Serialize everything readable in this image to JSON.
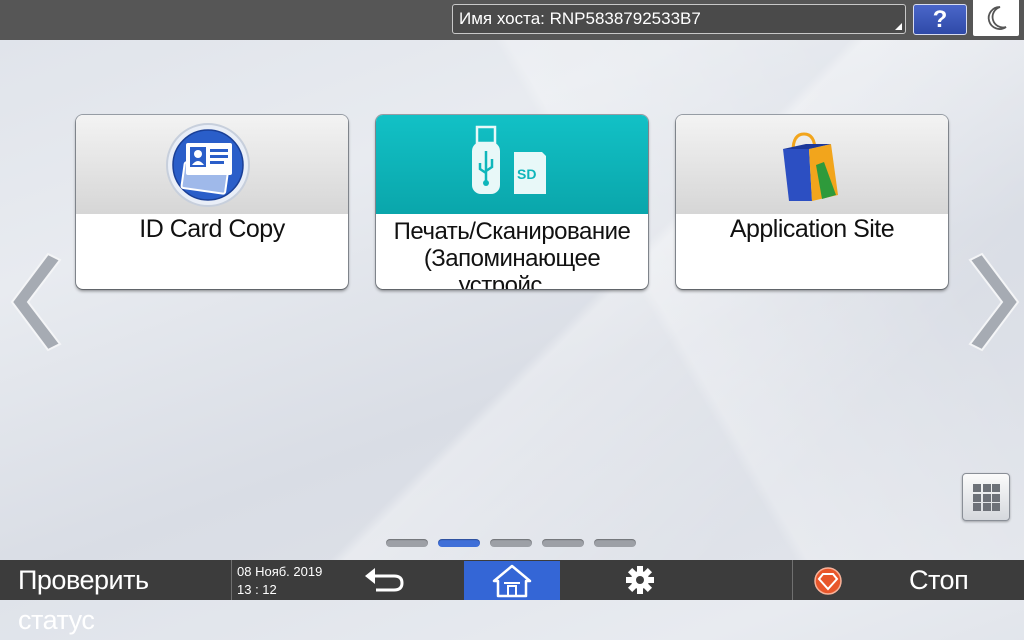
{
  "header": {
    "hostname_label": "Имя хоста: RNP5838792533B7",
    "help_label": "?"
  },
  "apps": [
    {
      "label": "ID Card Copy",
      "icon": "id-card-icon"
    },
    {
      "label_line1": "Печать/Сканирование",
      "label_line2": "(Запоминающее устройс…",
      "icon": "usb-sd-icon",
      "color": "#0fb6bb"
    },
    {
      "label": "Application Site",
      "icon": "shopping-bag-icon"
    }
  ],
  "pager": {
    "pages": 5,
    "active": 2
  },
  "footer": {
    "status_label": "Проверить статус",
    "date": "08 Нояб. 2019",
    "time": "13 : 12",
    "stop_label": "Стоп"
  },
  "colors": {
    "accent": "#3466d6",
    "topbar": "#565656",
    "bottombar": "#3c3c3c",
    "stop": "#e8562a"
  }
}
